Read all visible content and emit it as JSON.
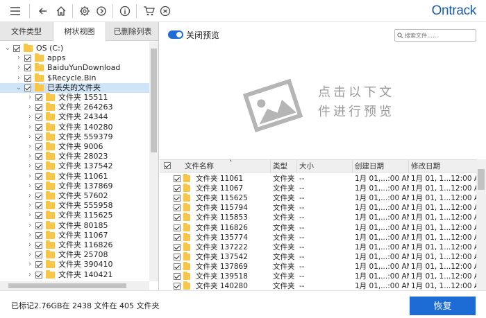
{
  "app": {
    "logo": "Ontrack"
  },
  "toolbar": {
    "icons": [
      "menu-icon",
      "back-icon",
      "home-icon",
      "gear-icon",
      "history-icon",
      "info-icon",
      "cart-icon",
      "user-icon"
    ]
  },
  "tabs": [
    {
      "label": "文件类型",
      "active": false
    },
    {
      "label": "树状视图",
      "active": true
    },
    {
      "label": "已删除列表",
      "active": false
    }
  ],
  "tree": [
    {
      "label": "OS (C:)",
      "level": 0,
      "expanded": true
    },
    {
      "label": "apps",
      "level": 1
    },
    {
      "label": "BaiduYunDownload",
      "level": 1
    },
    {
      "label": "$Recycle.Bin",
      "level": 1
    },
    {
      "label": "已丢失的文件夹",
      "level": 1,
      "selected": true,
      "expanded": true
    },
    {
      "label": "文件夹 15511",
      "level": 2
    },
    {
      "label": "文件夹 264263",
      "level": 2
    },
    {
      "label": "文件夹 24344",
      "level": 2
    },
    {
      "label": "文件夹 140280",
      "level": 2
    },
    {
      "label": "文件夹 559379",
      "level": 2
    },
    {
      "label": "文件夹 9006",
      "level": 2
    },
    {
      "label": "文件夹 28023",
      "level": 2
    },
    {
      "label": "文件夹 137542",
      "level": 2
    },
    {
      "label": "文件夹 11061",
      "level": 2
    },
    {
      "label": "文件夹 137869",
      "level": 2
    },
    {
      "label": "文件夹 57602",
      "level": 2
    },
    {
      "label": "文件夹 555958",
      "level": 2
    },
    {
      "label": "文件夹 115625",
      "level": 2
    },
    {
      "label": "文件夹 80185",
      "level": 2
    },
    {
      "label": "文件夹 11067",
      "level": 2
    },
    {
      "label": "文件夹 116826",
      "level": 2
    },
    {
      "label": "文件夹 25708",
      "level": 2
    },
    {
      "label": "文件夹 390410",
      "level": 2
    },
    {
      "label": "文件夹 140421",
      "level": 2
    }
  ],
  "preview": {
    "toggle_label": "关闭预览",
    "search_placeholder": "搜索文件……",
    "hint_line1": "点击以下文",
    "hint_line2": "件进行预览"
  },
  "table": {
    "columns": [
      "文件名称",
      "类型",
      "大小",
      "创建日期",
      "修改日期"
    ],
    "sort_arrow": "˄",
    "rows": [
      {
        "name": "文件夹 11061",
        "type": "文件夹",
        "size": "--",
        "created": "1月 01,...:00 AM",
        "modified": "1月 01, 1...12:00 AM"
      },
      {
        "name": "文件夹 11067",
        "type": "文件夹",
        "size": "--",
        "created": "1月 01,...:00 AM",
        "modified": "1月 01, 1...12:00 AM"
      },
      {
        "name": "文件夹 115625",
        "type": "文件夹",
        "size": "--",
        "created": "1月 01,...:00 AM",
        "modified": "1月 01, 1...12:00 AM"
      },
      {
        "name": "文件夹 115794",
        "type": "文件夹",
        "size": "--",
        "created": "1月 01,...:00 AM",
        "modified": "1月 01, 1...12:00 AM"
      },
      {
        "name": "文件夹 115853",
        "type": "文件夹",
        "size": "--",
        "created": "1月 01,...:00 AM",
        "modified": "1月 01, 1...12:00 AM"
      },
      {
        "name": "文件夹 116826",
        "type": "文件夹",
        "size": "--",
        "created": "1月 01,...:00 AM",
        "modified": "1月 01, 1...12:00 AM"
      },
      {
        "name": "文件夹 135774",
        "type": "文件夹",
        "size": "--",
        "created": "1月 01,...:00 AM",
        "modified": "1月 01, 1...12:00 AM"
      },
      {
        "name": "文件夹 137222",
        "type": "文件夹",
        "size": "--",
        "created": "1月 01,...:00 AM",
        "modified": "1月 01, 1...12:00 AM"
      },
      {
        "name": "文件夹 137542",
        "type": "文件夹",
        "size": "--",
        "created": "1月 01,...:00 AM",
        "modified": "1月 01, 1...12:00 AM"
      },
      {
        "name": "文件夹 137869",
        "type": "文件夹",
        "size": "--",
        "created": "1月 01,...:00 AM",
        "modified": "1月 01, 1...12:00 AM"
      },
      {
        "name": "文件夹 139518",
        "type": "文件夹",
        "size": "--",
        "created": "1月 01,...:00 AM",
        "modified": "1月 01, 1...12:00 AM"
      },
      {
        "name": "文件夹 140280",
        "type": "文件夹",
        "size": "--",
        "created": "1月 01,...:00 AM",
        "modified": "1月 01, 1...12:00 AM"
      }
    ]
  },
  "footer": {
    "status": "已标记2.76GB在 2438 文件在 405 文件夹",
    "restore_label": "恢复"
  },
  "colors": {
    "accent": "#1d6bd4",
    "logo": "#1d5da8",
    "folder": "#f7c64a",
    "selection": "#cfe4f7"
  }
}
